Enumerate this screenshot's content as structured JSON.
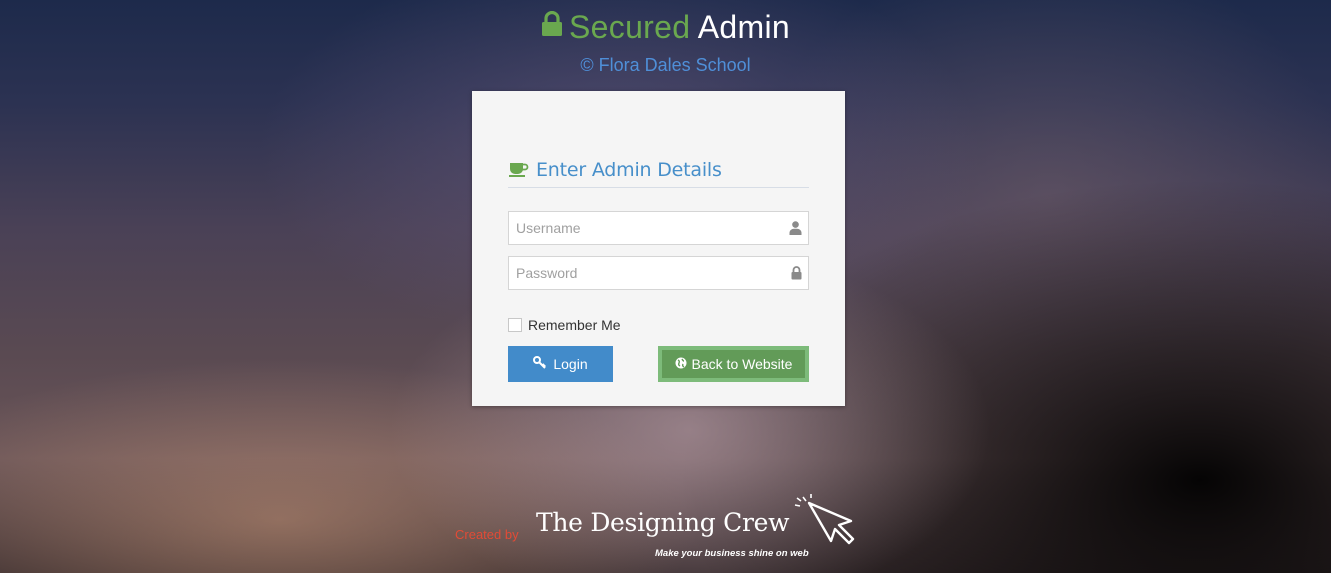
{
  "header": {
    "title_part1": "Secured",
    "title_part2": "Admin",
    "subtitle": "© Flora Dales School",
    "icon": "lock-icon"
  },
  "login_card": {
    "heading": "Enter Admin Details",
    "heading_icon": "coffee-cup-icon",
    "username": {
      "placeholder": "Username",
      "value": "",
      "icon": "user-icon"
    },
    "password": {
      "placeholder": "Password",
      "value": "",
      "icon": "lock-icon"
    },
    "remember_me": {
      "label": "Remember Me",
      "checked": false
    },
    "login_button": {
      "label": "Login",
      "icon": "key-icon"
    },
    "back_button": {
      "label": "Back to Website",
      "icon": "globe-icon"
    }
  },
  "footer": {
    "created_by": "Created by",
    "brand": "The Designing Crew",
    "tagline": "Make your business shine on web"
  },
  "colors": {
    "green": "#6aa84f",
    "blue": "#478fca",
    "login_button": "#428bca",
    "back_button": "#629b58",
    "created_by": "#e24b36"
  }
}
